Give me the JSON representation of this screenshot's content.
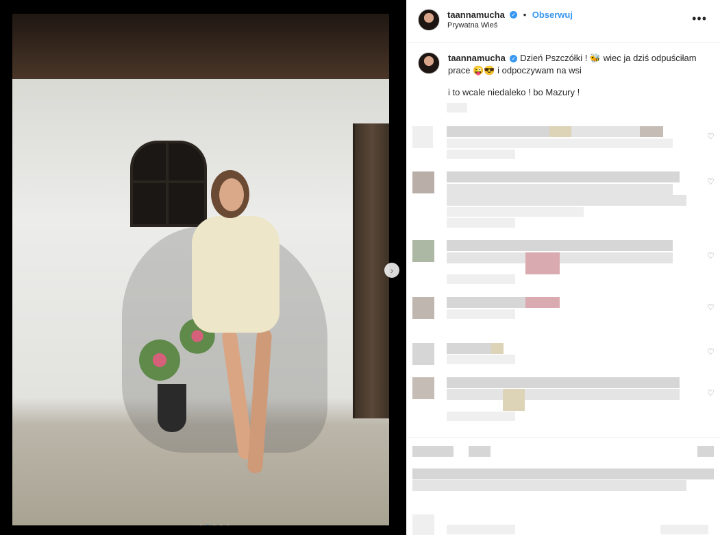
{
  "post": {
    "username": "taannamucha",
    "follow_label": "Obserwuj",
    "separator": "•",
    "location": "Prywatna Wieś",
    "more_label": "•••",
    "caption_line1": "Dzień Pszczółki ! 🐝 wiec ja dziś odpuściłam prace 😜😎 i odpoczywam na wsi",
    "caption_line2": "i to wcale niedaleko ! bo Mazury !",
    "verified_mark": "✓"
  },
  "carousel": {
    "next_label": "›",
    "dots": 5,
    "active_dot": 1
  },
  "colors": {
    "accent": "#3897f0",
    "text": "#262626",
    "border": "#efefef"
  }
}
